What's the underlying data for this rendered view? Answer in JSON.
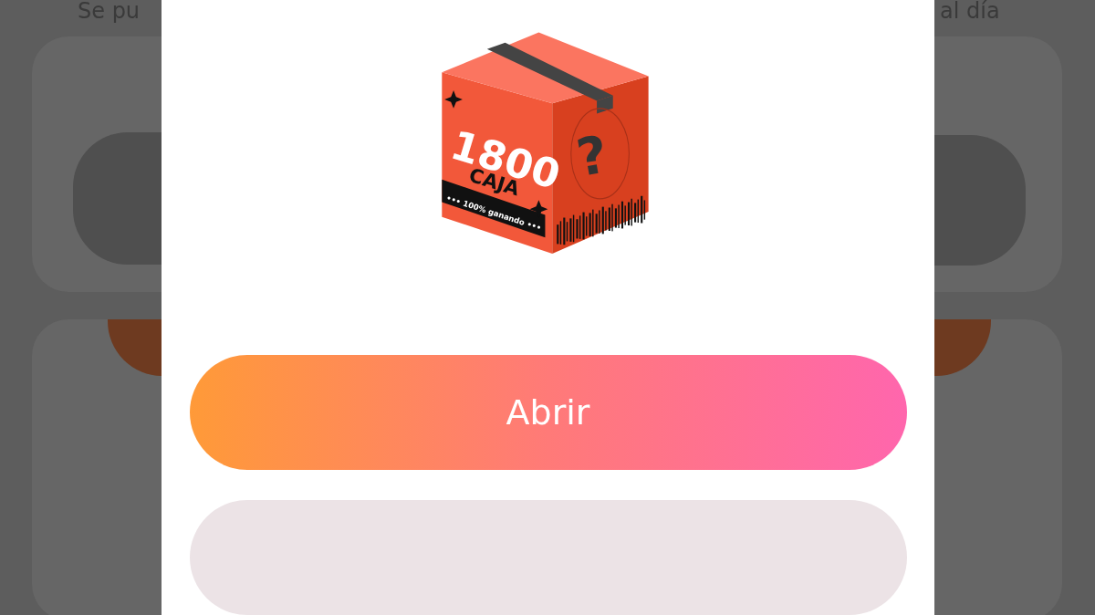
{
  "background": {
    "text_left": "Se pu",
    "text_right": "al día"
  },
  "prize_box": {
    "number": "1800",
    "word": "CAJA",
    "banner": "••• 100% ganando •••",
    "mark": "?"
  },
  "buttons": [
    {
      "label": "Abrir",
      "kind": "primary"
    },
    {
      "kind": "secondary"
    }
  ]
}
